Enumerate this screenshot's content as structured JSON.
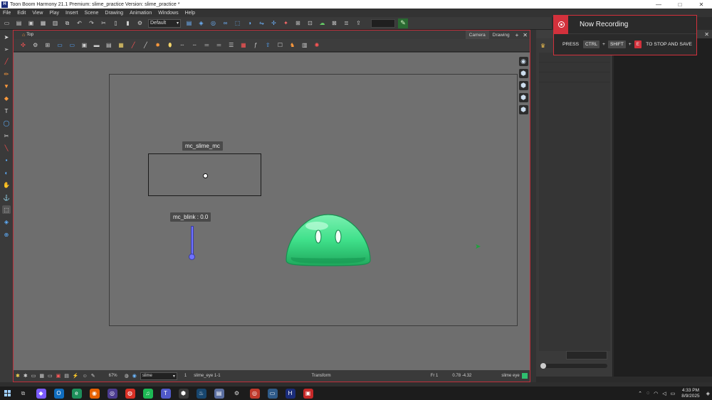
{
  "window": {
    "title": "Toon Boom Harmony 21.1 Premium: slime_practice Version: slime_practice *",
    "controls": [
      "—",
      "□",
      "✕"
    ]
  },
  "menu": [
    "File",
    "Edit",
    "View",
    "Play",
    "Insert",
    "Scene",
    "Drawing",
    "Animation",
    "Windows",
    "Help"
  ],
  "toolbar": {
    "workspace_select": "Default"
  },
  "view": {
    "name": "Top",
    "tabs": [
      "Camera",
      "Drawing"
    ],
    "add_tab": "+",
    "close": "✕"
  },
  "canvas": {
    "peg_label": "mc_slime_mc",
    "slider_label": "mc_blink : 0.0"
  },
  "statusbar": {
    "zoom": "67%",
    "color_select": "slime",
    "frame": "1",
    "layer_path": "slime_eye 1-1",
    "mode": "Transform",
    "fr_label": "Fr 1",
    "coords": "0.78 -4.32",
    "element": "slime eye"
  },
  "recording": {
    "title": "Now Recording",
    "press": "PRESS",
    "key1": "CTRL",
    "key2": "SHIFT",
    "key3": "E",
    "suffix": "TO STOP AND SAVE",
    "plus": "+"
  },
  "taskbar": {
    "time": "4:33 PM",
    "date": "8/9/2025"
  },
  "colors": {
    "accent_red": "#d3313c",
    "slime_green": "#3fe08a",
    "slider_blue": "#6f72ff"
  }
}
